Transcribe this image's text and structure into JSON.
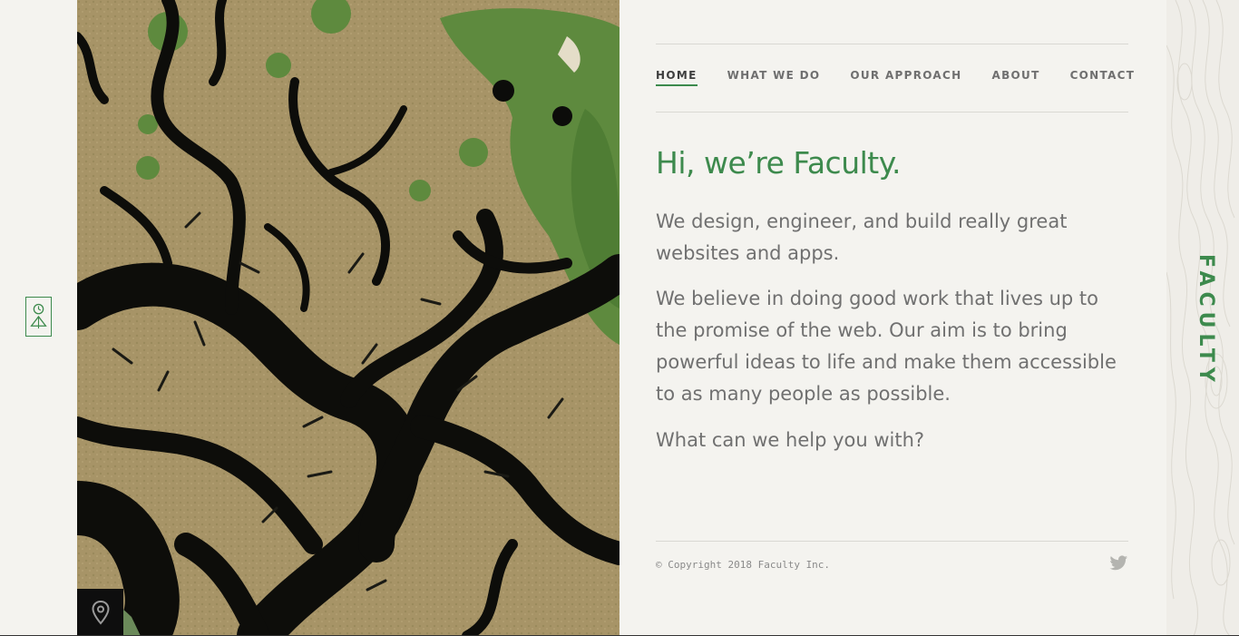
{
  "brand": {
    "name_vertical": "FACULTY",
    "accent_color": "#3d8a4d"
  },
  "nav": {
    "items": [
      {
        "label": "HOME",
        "active": true
      },
      {
        "label": "WHAT WE DO",
        "active": false
      },
      {
        "label": "OUR APPROACH",
        "active": false
      },
      {
        "label": "ABOUT",
        "active": false
      },
      {
        "label": "CONTACT",
        "active": false
      }
    ]
  },
  "main": {
    "headline": "Hi, we’re Faculty.",
    "paragraph_1": "We design, engineer, and build really great websites and apps.",
    "paragraph_2": "We believe in doing good work that lives up to the promise of the web. Our aim is to bring powerful ideas to life and make them accessible to as many people as possible.",
    "paragraph_3": "What can we help you with?"
  },
  "footer": {
    "copyright": "© Copyright 2018 Faculty Inc.",
    "social_icon": "twitter-icon"
  },
  "icons": {
    "logo": "faculty-logo-icon",
    "location": "map-pin-icon"
  }
}
